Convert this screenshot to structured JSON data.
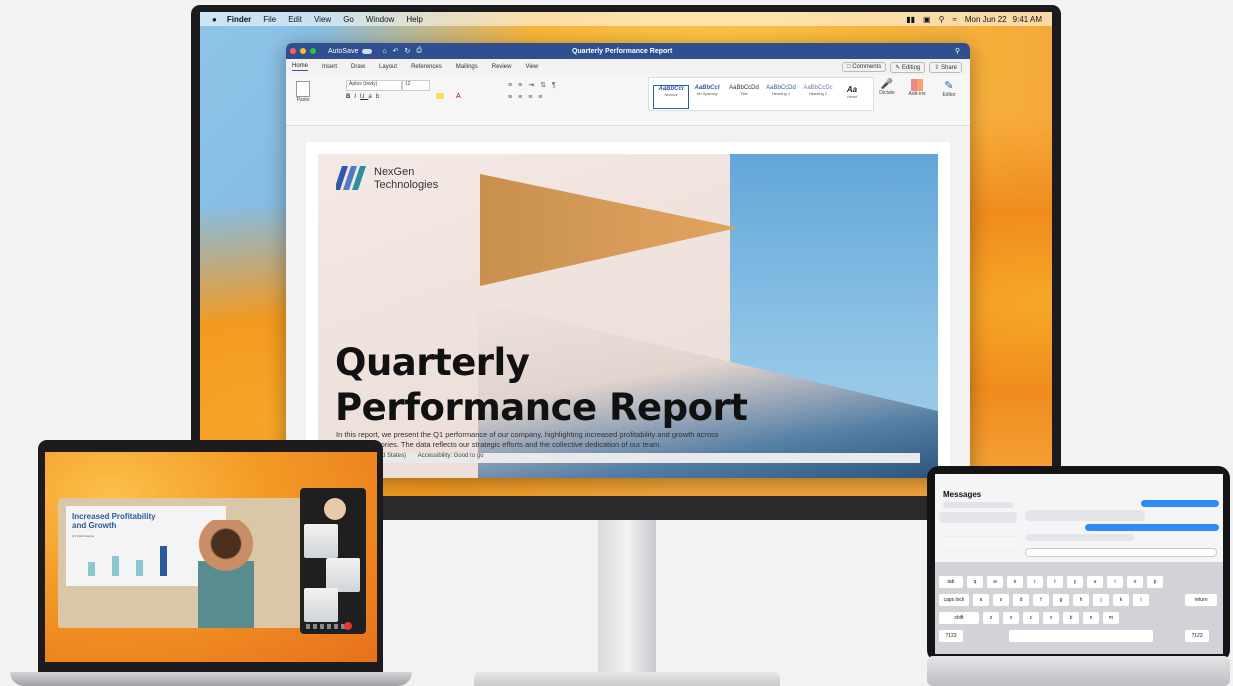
{
  "menubar": {
    "apple_icon": "apple-icon",
    "items": [
      "Finder",
      "File",
      "Edit",
      "View",
      "Go",
      "Window",
      "Help"
    ],
    "date": "Mon Jun 22",
    "time": "9:41 AM"
  },
  "word": {
    "autosave": "AutoSave",
    "title": "Quarterly Performance Report",
    "tabs": [
      "Home",
      "Insert",
      "Draw",
      "Layout",
      "References",
      "Mailings",
      "Review",
      "View"
    ],
    "comments": "Comments",
    "editing": "Editing",
    "share": "Share",
    "font": "Aptos (body)",
    "size": "12",
    "styles": [
      "AaBbCcI",
      "AaBbCcI",
      "AaBbCcDd",
      "AaBbCcDd",
      "AaBbCcDc",
      "Aa"
    ],
    "style_names": [
      "Normal",
      "No Spacing",
      "Title",
      "Heading 1",
      "Heading 2",
      "Head"
    ],
    "paste": "Paste",
    "dictate": "Dictate",
    "addins": "Add-ins",
    "editor": "Editor",
    "status_lang": "(United States)",
    "status_access": "Accessibility: Good to go"
  },
  "document": {
    "company_line1": "NexGen",
    "company_line2": "Technologies",
    "title_line1": "Quarterly",
    "title_line2": "Performance Report",
    "intro": "In this report, we present the Q1 performance of our company, highlighting increased profitability and growth across various categories. The data reflects our strategic efforts and the collective dedication of our team."
  },
  "laptop": {
    "slide_title_line1": "Increased Profitability",
    "slide_title_line2": "and Growth",
    "chart_label": "Q1 Performance"
  },
  "ipad": {
    "app_title": "Messages",
    "keys_row1": [
      "q",
      "w",
      "e",
      "r",
      "t",
      "y",
      "u",
      "i",
      "o",
      "p"
    ],
    "keys_row2": [
      "a",
      "s",
      "d",
      "f",
      "g",
      "h",
      "j",
      "k",
      "l"
    ],
    "keys_row3": [
      "z",
      "x",
      "c",
      "v",
      "b",
      "n",
      "m"
    ],
    "tab": "tab",
    "caps": "caps lock",
    "return": "return",
    "shift": "shift",
    "num": "?123"
  }
}
